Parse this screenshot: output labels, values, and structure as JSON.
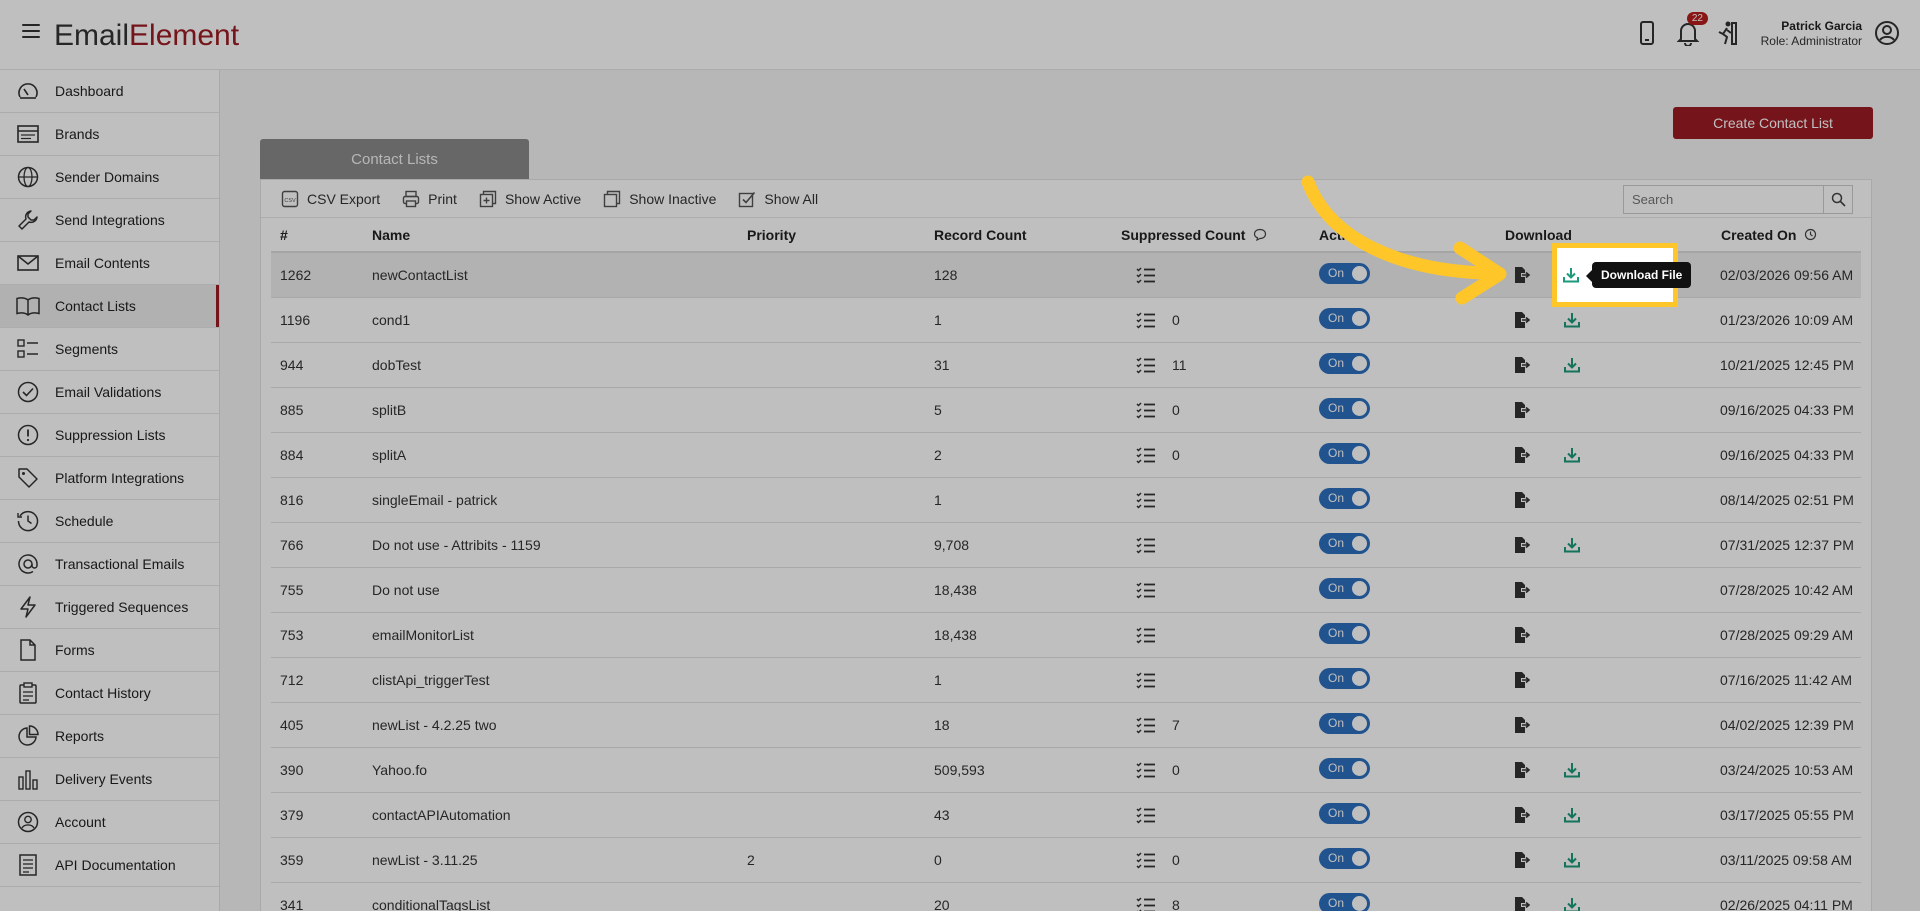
{
  "header": {
    "logo_part1": "Email",
    "logo_part2": "Element",
    "notification_count": "22",
    "user_name": "Patrick Garcia",
    "user_role": "Role: Administrator"
  },
  "sidebar": {
    "items": [
      {
        "label": "Dashboard",
        "icon": "gauge-icon"
      },
      {
        "label": "Brands",
        "icon": "brand-card-icon"
      },
      {
        "label": "Sender Domains",
        "icon": "globe-icon"
      },
      {
        "label": "Send Integrations",
        "icon": "wrench-icon"
      },
      {
        "label": "Email Contents",
        "icon": "envelope-icon"
      },
      {
        "label": "Contact Lists",
        "icon": "book-icon"
      },
      {
        "label": "Segments",
        "icon": "segments-icon"
      },
      {
        "label": "Email Validations",
        "icon": "check-circle-icon"
      },
      {
        "label": "Suppression Lists",
        "icon": "exclamation-circle-icon"
      },
      {
        "label": "Platform Integrations",
        "icon": "tag-icon"
      },
      {
        "label": "Schedule",
        "icon": "clock-icon"
      },
      {
        "label": "Transactional Emails",
        "icon": "at-icon"
      },
      {
        "label": "Triggered Sequences",
        "icon": "lightning-icon"
      },
      {
        "label": "Forms",
        "icon": "document-icon"
      },
      {
        "label": "Contact History",
        "icon": "clipboard-icon"
      },
      {
        "label": "Reports",
        "icon": "pie-chart-icon"
      },
      {
        "label": "Delivery Events",
        "icon": "bar-chart-icon"
      },
      {
        "label": "Account",
        "icon": "user-circle-icon"
      },
      {
        "label": "API Documentation",
        "icon": "api-doc-icon"
      }
    ],
    "active_index": 5
  },
  "main": {
    "create_button": "Create Contact List",
    "tab_label": "Contact Lists",
    "toolbar": {
      "csv_export": "CSV Export",
      "print": "Print",
      "show_active": "Show Active",
      "show_inactive": "Show Inactive",
      "show_all": "Show All"
    },
    "search_placeholder": "Search",
    "columns": {
      "id": "#",
      "name": "Name",
      "priority": "Priority",
      "record_count": "Record Count",
      "suppressed_count": "Suppressed Count",
      "active": "Acti",
      "download": "Download",
      "created_on": "Created On"
    },
    "toggle_label": "On",
    "tooltip": "Download File",
    "rows": [
      {
        "id": "1262",
        "name": "newContactList",
        "priority": "",
        "record_count": "128",
        "suppressed": "",
        "has_file": true,
        "created": "02/03/2026 09:56 AM"
      },
      {
        "id": "1196",
        "name": "cond1",
        "priority": "",
        "record_count": "1",
        "suppressed": "0",
        "has_file": true,
        "created": "01/23/2026 10:09 AM"
      },
      {
        "id": "944",
        "name": "dobTest",
        "priority": "",
        "record_count": "31",
        "suppressed": "11",
        "has_file": true,
        "created": "10/21/2025 12:45 PM"
      },
      {
        "id": "885",
        "name": "splitB",
        "priority": "",
        "record_count": "5",
        "suppressed": "0",
        "has_file": false,
        "created": "09/16/2025 04:33 PM"
      },
      {
        "id": "884",
        "name": "splitA",
        "priority": "",
        "record_count": "2",
        "suppressed": "0",
        "has_file": true,
        "created": "09/16/2025 04:33 PM"
      },
      {
        "id": "816",
        "name": "singleEmail - patrick",
        "priority": "",
        "record_count": "1",
        "suppressed": "",
        "has_file": false,
        "created": "08/14/2025 02:51 PM"
      },
      {
        "id": "766",
        "name": "Do not use - Attribits - 1159",
        "priority": "",
        "record_count": "9,708",
        "suppressed": "",
        "has_file": true,
        "created": "07/31/2025 12:37 PM"
      },
      {
        "id": "755",
        "name": "Do not use",
        "priority": "",
        "record_count": "18,438",
        "suppressed": "",
        "has_file": false,
        "created": "07/28/2025 10:42 AM"
      },
      {
        "id": "753",
        "name": "emailMonitorList",
        "priority": "",
        "record_count": "18,438",
        "suppressed": "",
        "has_file": false,
        "created": "07/28/2025 09:29 AM"
      },
      {
        "id": "712",
        "name": "clistApi_triggerTest",
        "priority": "",
        "record_count": "1",
        "suppressed": "",
        "has_file": false,
        "created": "07/16/2025 11:42 AM"
      },
      {
        "id": "405",
        "name": "newList - 4.2.25 two",
        "priority": "",
        "record_count": "18",
        "suppressed": "7",
        "has_file": false,
        "created": "04/02/2025 12:39 PM"
      },
      {
        "id": "390",
        "name": "Yahoo.fo",
        "priority": "",
        "record_count": "509,593",
        "suppressed": "0",
        "has_file": true,
        "created": "03/24/2025 10:53 AM"
      },
      {
        "id": "379",
        "name": "contactAPIAutomation",
        "priority": "",
        "record_count": "43",
        "suppressed": "",
        "has_file": true,
        "created": "03/17/2025 05:55 PM"
      },
      {
        "id": "359",
        "name": "newList - 3.11.25",
        "priority": "2",
        "record_count": "0",
        "suppressed": "0",
        "has_file": true,
        "created": "03/11/2025 09:58 AM"
      },
      {
        "id": "341",
        "name": "conditionalTagsList",
        "priority": "",
        "record_count": "20",
        "suppressed": "8",
        "has_file": true,
        "created": "02/26/2025 04:11 PM"
      }
    ]
  },
  "colors": {
    "brand": "#9d1c24",
    "toggle": "#2d6fbe",
    "download_file": "#1a9a7a",
    "highlight": "#ffc629"
  }
}
